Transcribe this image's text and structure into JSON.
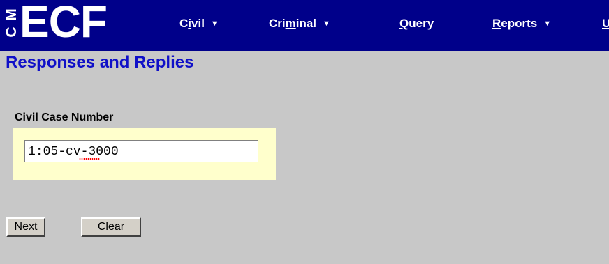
{
  "app": {
    "logo_side": [
      "C",
      "M"
    ],
    "logo_text": "ECF"
  },
  "nav": {
    "items": [
      {
        "pre": "C",
        "u": "i",
        "post": "vil",
        "caret": "▼"
      },
      {
        "pre": "Cri",
        "u": "m",
        "post": "inal",
        "caret": "▼"
      },
      {
        "pre": "",
        "u": "Q",
        "post": "uery",
        "caret": ""
      },
      {
        "pre": "",
        "u": "R",
        "post": "eports",
        "caret": "▼"
      },
      {
        "pre": "",
        "u": "U",
        "post": "",
        "caret": ""
      }
    ]
  },
  "page": {
    "title": "Responses and Replies"
  },
  "form": {
    "case_number_label": "Civil Case Number",
    "case_number_value": "1:05-cv-3000"
  },
  "buttons": {
    "next_label": "Next",
    "clear_label": "Clear"
  },
  "colors": {
    "topbar": "#00008a",
    "title": "#1010c8",
    "background": "#c8c8c8",
    "field_highlight": "#ffffcc"
  }
}
